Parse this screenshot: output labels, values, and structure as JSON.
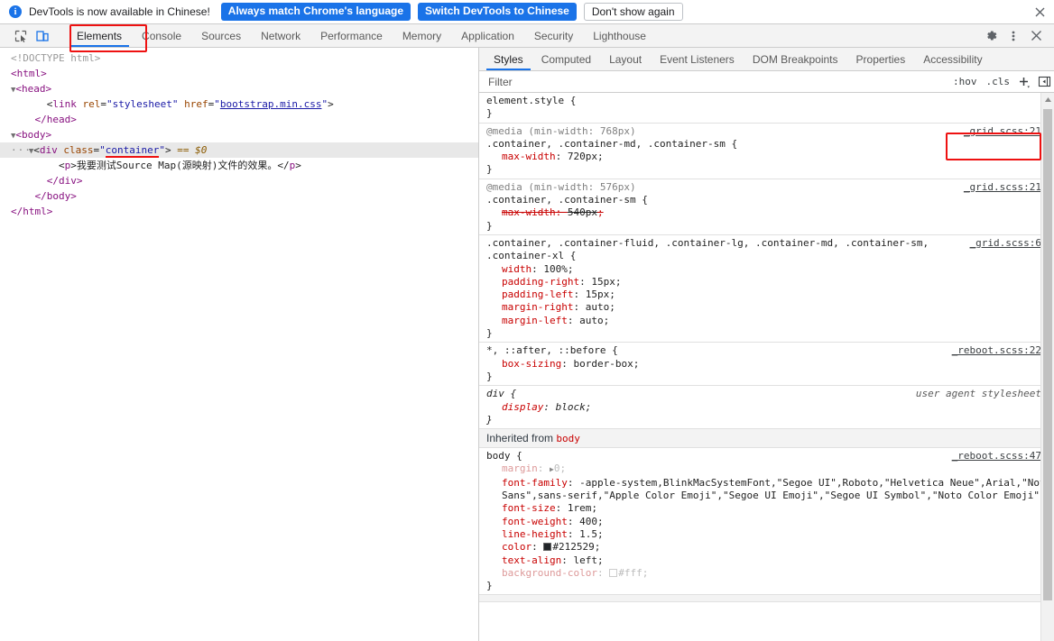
{
  "infobar": {
    "message": "DevTools is now available in Chinese!",
    "buttons": [
      {
        "label": "Always match Chrome's language",
        "style": "primary"
      },
      {
        "label": "Switch DevTools to Chinese",
        "style": "primary"
      },
      {
        "label": "Don't show again",
        "style": "secondary"
      }
    ],
    "close_icon": "close-icon"
  },
  "toolbar": {
    "icons": [
      {
        "name": "inspect-element-icon",
        "active": false
      },
      {
        "name": "device-toolbar-icon",
        "active": true
      }
    ],
    "tabs": [
      {
        "label": "Elements",
        "active": true
      },
      {
        "label": "Console",
        "active": false
      },
      {
        "label": "Sources",
        "active": false
      },
      {
        "label": "Network",
        "active": false
      },
      {
        "label": "Performance",
        "active": false
      },
      {
        "label": "Memory",
        "active": false
      },
      {
        "label": "Application",
        "active": false
      },
      {
        "label": "Security",
        "active": false
      },
      {
        "label": "Lighthouse",
        "active": false
      }
    ],
    "right_icons": [
      "settings-gear-icon",
      "more-options-icon",
      "close-devtools-icon"
    ]
  },
  "dom_tree": {
    "lines": [
      {
        "indent": 0,
        "type": "doctype",
        "text": "<!DOCTYPE html>"
      },
      {
        "indent": 0,
        "type": "tag",
        "text": "<html>"
      },
      {
        "indent": 0,
        "type": "tag-expand",
        "text": "<head>"
      },
      {
        "indent": 1,
        "type": "link",
        "text": "<link rel=\"stylesheet\" href=\"bootstrap.min.css\">"
      },
      {
        "indent": 1,
        "type": "tag",
        "text": "</head>"
      },
      {
        "indent": 0,
        "type": "tag-expand",
        "text": "<body>"
      },
      {
        "indent": 1,
        "type": "selected",
        "text": "<div class=\"container\"> == $0"
      },
      {
        "indent": 2,
        "type": "text",
        "text": "<p>我要测试Source Map(源映射)文件的效果。</p>"
      },
      {
        "indent": 2,
        "type": "tag",
        "text": "</div>"
      },
      {
        "indent": 1,
        "type": "tag",
        "text": "</body>"
      },
      {
        "indent": 0,
        "type": "tag",
        "text": "</html>"
      }
    ],
    "selected_attr_value": "container",
    "selected_suffix": "== $0",
    "link_href": "bootstrap.min.css",
    "paragraph_text": "我要测试Source Map(源映射)文件的效果。"
  },
  "styles_panel": {
    "tabs": [
      {
        "label": "Styles",
        "active": true
      },
      {
        "label": "Computed",
        "active": false
      },
      {
        "label": "Layout",
        "active": false
      },
      {
        "label": "Event Listeners",
        "active": false
      },
      {
        "label": "DOM Breakpoints",
        "active": false
      },
      {
        "label": "Properties",
        "active": false
      },
      {
        "label": "Accessibility",
        "active": false
      }
    ],
    "filter": {
      "placeholder": "Filter",
      "value": ""
    },
    "filter_buttons": [
      {
        "label": ":hov",
        "name": "toggle-element-state-button"
      },
      {
        "label": ".cls",
        "name": "element-classes-button"
      }
    ],
    "filter_icons": [
      "new-style-rule-icon",
      "toggle-computed-sidebar-icon"
    ],
    "rules": [
      {
        "id": "element-style",
        "selector": "element.style",
        "origin": "",
        "declarations": []
      },
      {
        "id": "grid-768",
        "media": "@media (min-width: 768px)",
        "selector": ".container, .container-md, .container-sm",
        "origin": "_grid.scss:21",
        "highlighted": true,
        "declarations": [
          {
            "prop": "max-width",
            "value": "720px",
            "state": "active"
          }
        ]
      },
      {
        "id": "grid-576",
        "media": "@media (min-width: 576px)",
        "selector": ".container, .container-sm",
        "origin": "_grid.scss:21",
        "declarations": [
          {
            "prop": "max-width",
            "value": "540px",
            "state": "overridden"
          }
        ]
      },
      {
        "id": "grid-base",
        "selector": ".container, .container-fluid, .container-lg, .container-md, .container-sm, .container-xl",
        "origin": "_grid.scss:6",
        "declarations": [
          {
            "prop": "width",
            "value": "100%",
            "state": "active"
          },
          {
            "prop": "padding-right",
            "value": "15px",
            "state": "active"
          },
          {
            "prop": "padding-left",
            "value": "15px",
            "state": "active"
          },
          {
            "prop": "margin-right",
            "value": "auto",
            "state": "active"
          },
          {
            "prop": "margin-left",
            "value": "auto",
            "state": "active"
          }
        ]
      },
      {
        "id": "reboot-universal",
        "selector": "*, ::after, ::before",
        "origin": "_reboot.scss:22",
        "declarations": [
          {
            "prop": "box-sizing",
            "value": "border-box",
            "state": "active"
          }
        ]
      },
      {
        "id": "ua-div",
        "selector": "div",
        "origin": "user agent stylesheet",
        "user_agent": true,
        "declarations": [
          {
            "prop": "display",
            "value": "block",
            "state": "active"
          }
        ]
      }
    ],
    "inherited_label": "Inherited from",
    "inherited_from": "body",
    "body_rule": {
      "selector": "body",
      "origin": "_reboot.scss:47",
      "declarations": [
        {
          "prop": "margin",
          "value": "0",
          "state": "expandable-dim"
        },
        {
          "prop": "font-family",
          "value": "-apple-system,BlinkMacSystemFont,\"Segoe UI\",Roboto,\"Helvetica Neue\",Arial,\"Noto Sans\",sans-serif,\"Apple Color Emoji\",\"Segoe UI Emoji\",\"Segoe UI Symbol\",\"Noto Color Emoji\"",
          "state": "active"
        },
        {
          "prop": "font-size",
          "value": "1rem",
          "state": "active"
        },
        {
          "prop": "font-weight",
          "value": "400",
          "state": "active"
        },
        {
          "prop": "line-height",
          "value": "1.5",
          "state": "active"
        },
        {
          "prop": "color",
          "value": "#212529",
          "state": "active",
          "swatch": "#212529"
        },
        {
          "prop": "text-align",
          "value": "left",
          "state": "active"
        },
        {
          "prop": "background-color",
          "value": "#fff",
          "state": "dim",
          "swatch": "#ffffff"
        }
      ]
    }
  },
  "colors": {
    "accent_blue": "#1a73e8",
    "annotation_red": "#ee1111",
    "property_red": "#c80000",
    "tag_purple": "#881280",
    "attr_orange": "#994500",
    "attr_value_blue": "#1a1aa6"
  }
}
